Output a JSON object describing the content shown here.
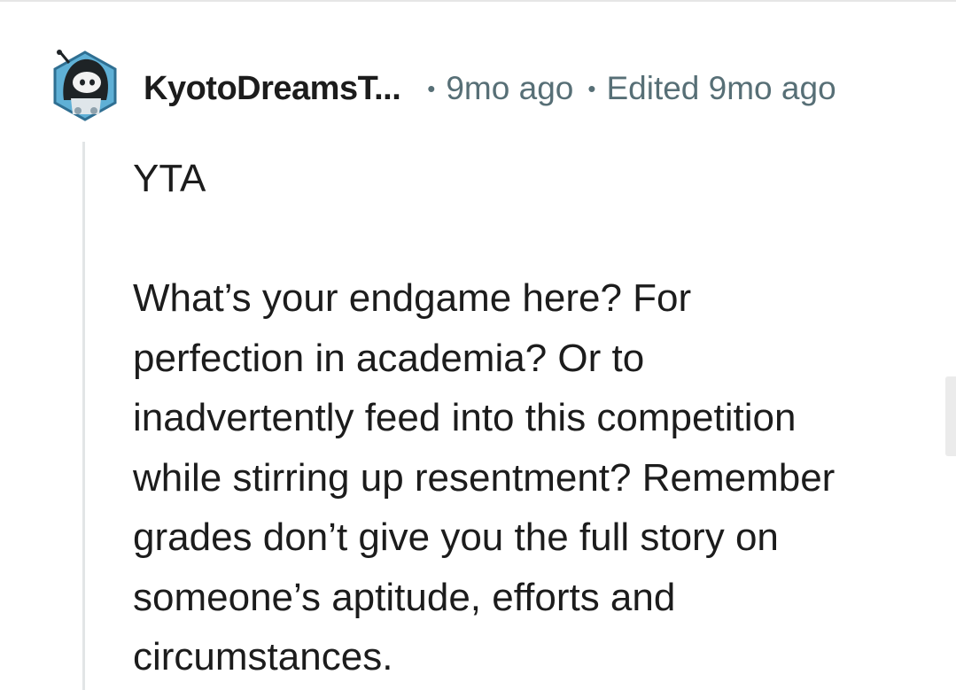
{
  "comment": {
    "author": "KyotoDreamsT...",
    "separator": "•",
    "timestamp": "9mo ago",
    "edited": "Edited 9mo ago",
    "verdict": "YTA",
    "lines": [
      "What’s your endgame here? For",
      "perfection in academia? Or to",
      "inadvertently feed into this competition",
      "while stirring up resentment? Remember",
      "grades don’t give you the full story on",
      "someone’s aptitude, efforts and",
      "circumstances."
    ]
  },
  "avatar": {
    "icon": "snoo-avatar-icon",
    "colors": {
      "hex_fill": "#5fb0d6",
      "hex_border": "#2f6f92",
      "hood": "#1e2326",
      "face": "#f2f2f2"
    }
  },
  "colors": {
    "text": "#1c1c1c",
    "meta": "#576f76",
    "thread_line": "#e2e5e6",
    "background": "#ffffff"
  }
}
